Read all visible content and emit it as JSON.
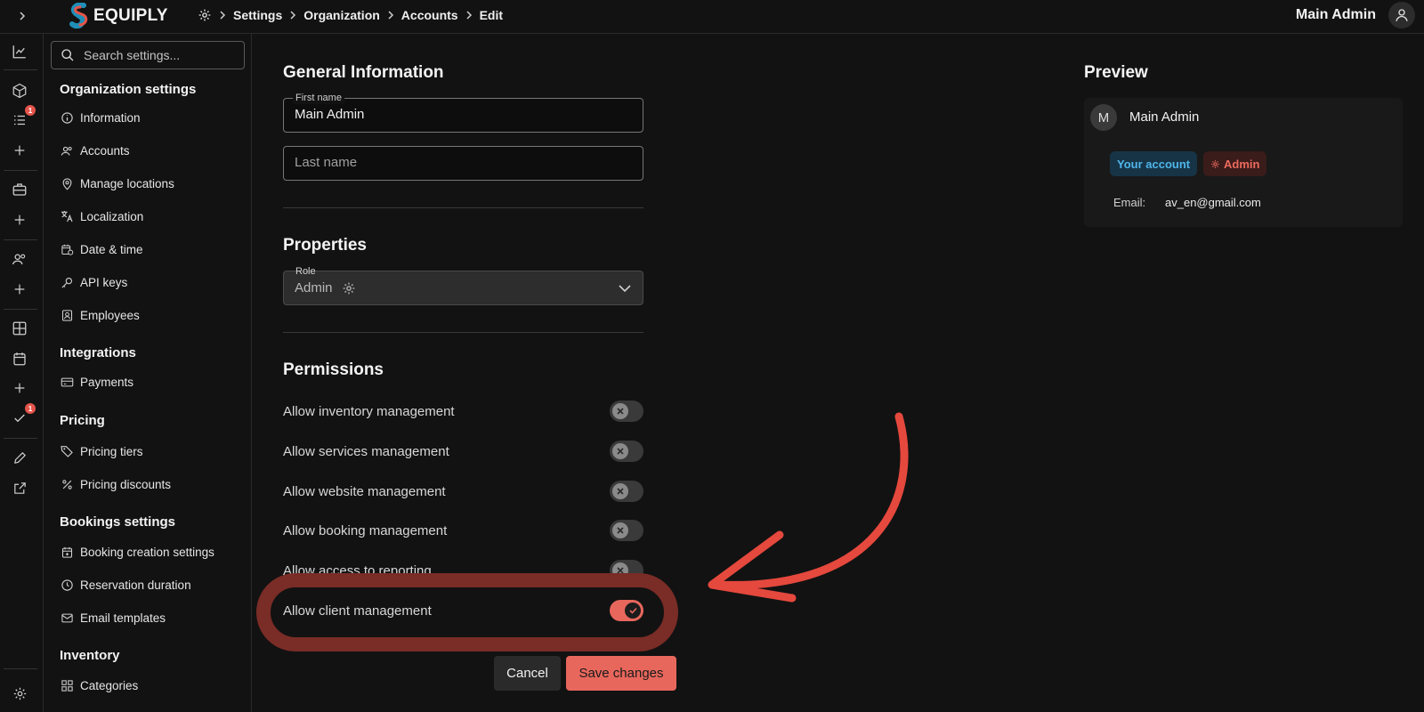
{
  "brand": {
    "name": "EQUIPLY",
    "accent": "#e8675c",
    "logo_blue": "#1f8fb7",
    "logo_red": "#e5544a"
  },
  "breadcrumb": [
    "Settings",
    "Organization",
    "Accounts",
    "Edit"
  ],
  "user": {
    "name": "Main Admin"
  },
  "rail": {
    "icons": [
      "chart-icon",
      "box-icon",
      "list-icon",
      "plus-icon",
      "briefcase-icon",
      "plus-icon",
      "users-icon",
      "plus-icon",
      "grid-icon",
      "calendar-icon",
      "plus-icon",
      "check-icon",
      "pencil-icon",
      "external-link-icon",
      "gear-icon"
    ],
    "badges": {
      "list": "1",
      "check": "1"
    }
  },
  "sidebar": {
    "search_placeholder": "Search settings...",
    "sections": [
      {
        "title": "Organization settings",
        "items": [
          "Information",
          "Accounts",
          "Manage locations",
          "Localization",
          "Date & time",
          "API keys",
          "Employees"
        ]
      },
      {
        "title": "Integrations",
        "items": [
          "Payments"
        ]
      },
      {
        "title": "Pricing",
        "items": [
          "Pricing tiers",
          "Pricing discounts"
        ]
      },
      {
        "title": "Bookings settings",
        "items": [
          "Booking creation settings",
          "Reservation duration",
          "Email templates"
        ]
      },
      {
        "title": "Inventory",
        "items": [
          "Categories"
        ]
      }
    ]
  },
  "general": {
    "title": "General Information",
    "first_name_label": "First name",
    "first_name_value": "Main Admin",
    "last_name_placeholder": "Last name"
  },
  "properties": {
    "title": "Properties",
    "role_label": "Role",
    "role_value": "Admin"
  },
  "permissions": {
    "title": "Permissions",
    "items": [
      {
        "label": "Allow inventory management",
        "enabled": false
      },
      {
        "label": "Allow services management",
        "enabled": false
      },
      {
        "label": "Allow website management",
        "enabled": false
      },
      {
        "label": "Allow booking management",
        "enabled": false
      },
      {
        "label": "Allow access to reporting",
        "enabled": false
      },
      {
        "label": "Allow client management",
        "enabled": true
      }
    ]
  },
  "actions": {
    "cancel": "Cancel",
    "save": "Save changes"
  },
  "preview": {
    "title": "Preview",
    "avatar_initial": "M",
    "name": "Main Admin",
    "tag_account": "Your account",
    "tag_role": "Admin",
    "email_label": "Email:",
    "email": "av_en@gmail.com"
  },
  "annotation": {
    "color": "#e5483d",
    "highlight_color": "#7a2c26"
  }
}
